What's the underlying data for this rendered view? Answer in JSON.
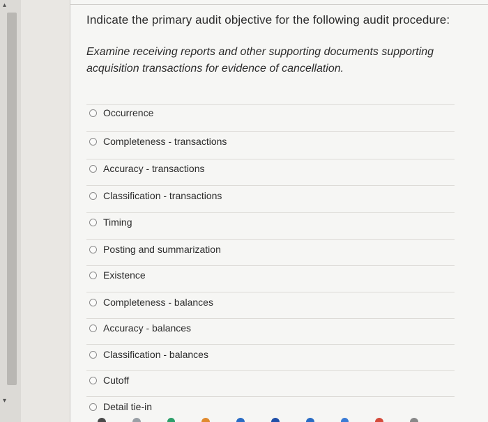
{
  "question": {
    "prompt": "Indicate the primary audit objective for the following audit procedure:",
    "procedure": "Examine receiving reports and other supporting documents supporting acquisition transactions for evidence of cancellation."
  },
  "options": [
    {
      "label": "Occurrence"
    },
    {
      "label": "Completeness - transactions"
    },
    {
      "label": "Accuracy - transactions"
    },
    {
      "label": "Classification - transactions"
    },
    {
      "label": "Timing"
    },
    {
      "label": "Posting and summarization"
    },
    {
      "label": "Existence"
    },
    {
      "label": "Completeness - balances"
    },
    {
      "label": "Accuracy - balances"
    },
    {
      "label": "Classification - balances"
    },
    {
      "label": "Cutoff"
    },
    {
      "label": "Detail tie-in"
    }
  ],
  "dock": {
    "icon_colors": [
      "#4a4a4a",
      "#9aa0a6",
      "#2d9f6a",
      "#e08a2e",
      "#2a6cc4",
      "#1f4fa8",
      "#2a6cc4",
      "#3a7bd5",
      "#d44a3a",
      "#888888"
    ]
  }
}
